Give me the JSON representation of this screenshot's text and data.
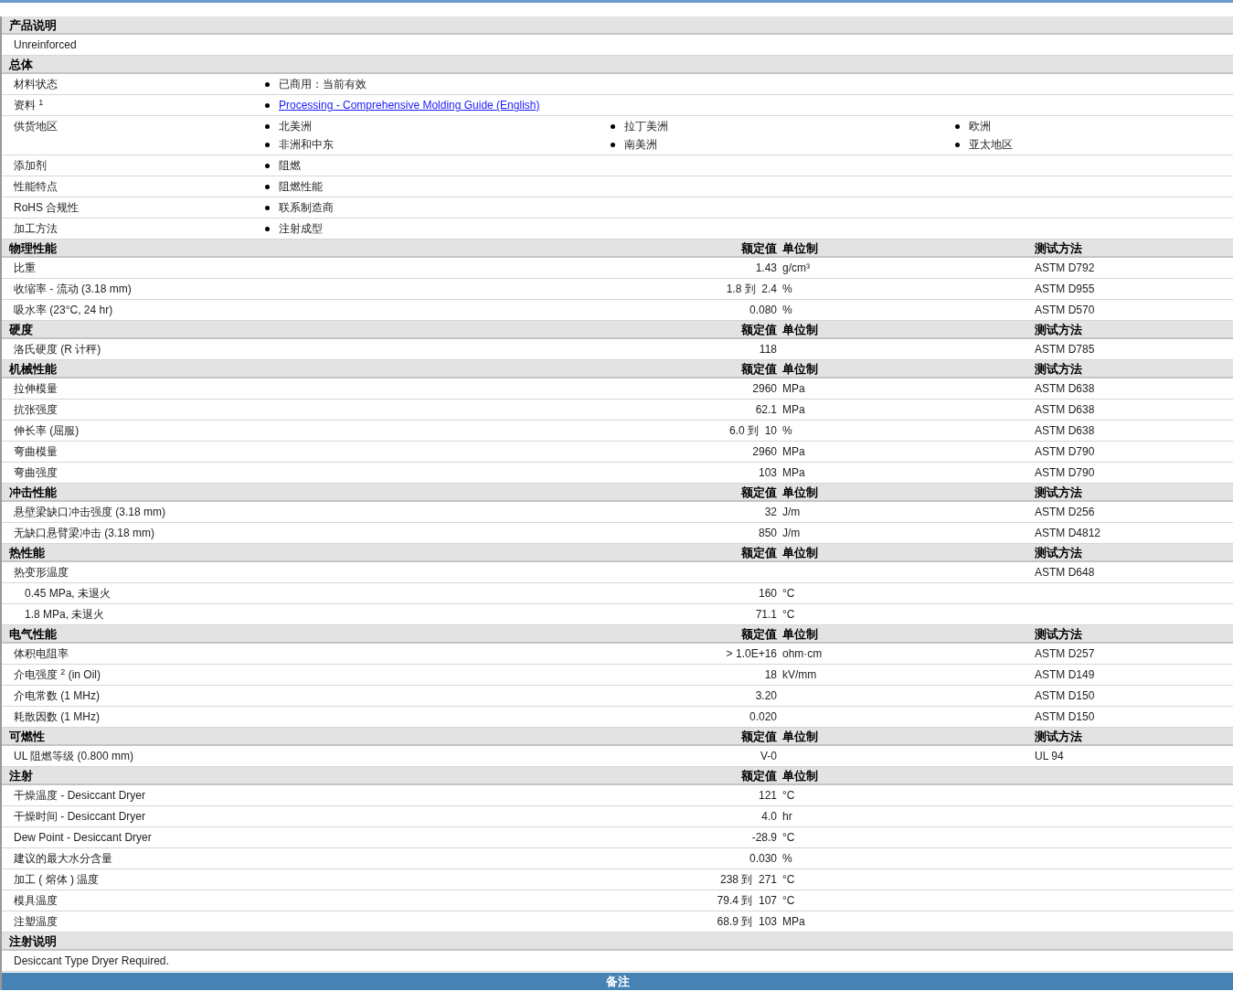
{
  "sections": [
    {
      "title": "产品说明",
      "kind": "text",
      "text": "Unreinforced"
    },
    {
      "title": "总体",
      "kind": "general",
      "rows": [
        {
          "label": "材料状态",
          "items": [
            {
              "kind": "text",
              "text": "已商用：当前有效"
            }
          ]
        },
        {
          "label": "资料 $^{1}$",
          "items": [
            {
              "kind": "link",
              "text": "Processing - Comprehensive Molding Guide (English)"
            }
          ]
        },
        {
          "label": "供货地区",
          "items": [
            {
              "kind": "text",
              "text": "北美洲"
            },
            {
              "kind": "text",
              "text": "拉丁美洲"
            },
            {
              "kind": "text",
              "text": "欧洲"
            },
            {
              "kind": "text",
              "text": "非洲和中东"
            },
            {
              "kind": "text",
              "text": "南美洲"
            },
            {
              "kind": "text",
              "text": "亚太地区"
            }
          ]
        },
        {
          "label": "添加剂",
          "items": [
            {
              "kind": "text",
              "text": "阻燃"
            }
          ]
        },
        {
          "label": "性能特点",
          "items": [
            {
              "kind": "text",
              "text": "阻燃性能"
            }
          ]
        },
        {
          "label": "RoHS 合规性",
          "items": [
            {
              "kind": "text",
              "text": "联系制造商"
            }
          ]
        },
        {
          "label": "加工方法",
          "items": [
            {
              "kind": "text",
              "text": "注射成型"
            }
          ]
        }
      ]
    },
    {
      "title": "物理性能",
      "kind": "properties",
      "header": {
        "value": "额定值",
        "unit": "单位制",
        "method": "测试方法"
      },
      "rows": [
        {
          "label": "比重",
          "value": "1.43",
          "unit": "g/cm³",
          "method": "ASTM D792"
        },
        {
          "label": "收缩率 - 流动 (3.18 mm)",
          "value": "1.8 到  2.4",
          "unit": "%",
          "method": "ASTM D955"
        },
        {
          "label": "吸水率 (23°C, 24 hr)",
          "value": "0.080",
          "unit": "%",
          "method": "ASTM D570"
        }
      ]
    },
    {
      "title": "硬度",
      "kind": "properties",
      "header": {
        "value": "额定值",
        "unit": "单位制",
        "method": "测试方法"
      },
      "rows": [
        {
          "label": "洛氏硬度 (R 计秤)",
          "value": "118",
          "method": "ASTM D785"
        }
      ]
    },
    {
      "title": "机械性能",
      "kind": "properties",
      "header": {
        "value": "额定值",
        "unit": "单位制",
        "method": "测试方法"
      },
      "rows": [
        {
          "label": "拉伸模量",
          "value": "2960",
          "unit": "MPa",
          "method": "ASTM D638"
        },
        {
          "label": "抗张强度",
          "value": "62.1",
          "unit": "MPa",
          "method": "ASTM D638"
        },
        {
          "label": "伸长率 (屈服)",
          "value": "6.0 到  10",
          "unit": "%",
          "method": "ASTM D638"
        },
        {
          "label": "弯曲模量",
          "value": "2960",
          "unit": "MPa",
          "method": "ASTM D790"
        },
        {
          "label": "弯曲强度",
          "value": "103",
          "unit": "MPa",
          "method": "ASTM D790"
        }
      ]
    },
    {
      "title": "冲击性能",
      "kind": "properties",
      "header": {
        "value": "额定值",
        "unit": "单位制",
        "method": "测试方法"
      },
      "rows": [
        {
          "label": "悬壁梁缺口冲击强度 (3.18 mm)",
          "value": "32",
          "unit": "J/m",
          "method": "ASTM D256"
        },
        {
          "label": "无缺口悬臂梁冲击 (3.18 mm)",
          "value": "850",
          "unit": "J/m",
          "method": "ASTM D4812"
        }
      ]
    },
    {
      "title": "热性能",
      "kind": "properties",
      "header": {
        "value": "额定值",
        "unit": "单位制",
        "method": "测试方法"
      },
      "rows": [
        {
          "label": "热变形温度",
          "method": "ASTM D648",
          "children": [
            {
              "label": "0.45 MPa, 未退火",
              "value": "160",
              "unit": "°C"
            },
            {
              "label": "1.8 MPa, 未退火",
              "value": "71.1",
              "unit": "°C"
            }
          ]
        }
      ]
    },
    {
      "title": "电气性能",
      "kind": "properties",
      "header": {
        "value": "额定值",
        "unit": "单位制",
        "method": "测试方法"
      },
      "rows": [
        {
          "label": "体积电阻率",
          "value": "> 1.0E+16",
          "unit": "ohm·cm",
          "method": "ASTM D257"
        },
        {
          "label": "介电强度 $^{2}$ (in Oil)",
          "value": "18",
          "unit": "kV/mm",
          "method": "ASTM D149"
        },
        {
          "label": "介电常数 (1 MHz)",
          "value": "3.20",
          "method": "ASTM D150"
        },
        {
          "label": "耗散因数 (1 MHz)",
          "value": "0.020",
          "method": "ASTM D150"
        }
      ]
    },
    {
      "title": "可燃性",
      "kind": "properties",
      "header": {
        "value": "额定值",
        "unit": "单位制",
        "method": "测试方法"
      },
      "rows": [
        {
          "label": "UL 阻燃等级 (0.800 mm)",
          "value": "V-0",
          "method": "UL 94"
        }
      ]
    },
    {
      "title": "注射",
      "kind": "properties",
      "header": {
        "value": "额定值",
        "unit": "单位制"
      },
      "rows": [
        {
          "label": "干燥温度 - Desiccant Dryer",
          "value": "121",
          "unit": "°C"
        },
        {
          "label": "干燥时间 - Desiccant Dryer",
          "value": "4.0",
          "unit": "hr"
        },
        {
          "label": "Dew Point - Desiccant Dryer",
          "value": "-28.9",
          "unit": "°C"
        },
        {
          "label": "建议的最大水分含量",
          "value": "0.030",
          "unit": "%"
        },
        {
          "label": "加工 ( 熔体 ) 温度",
          "value": "238 到  271",
          "unit": "°C"
        },
        {
          "label": "模具温度",
          "value": "79.4 到  107",
          "unit": "°C"
        },
        {
          "label": "注塑温度",
          "value": "68.9 到  103",
          "unit": "MPa"
        }
      ]
    },
    {
      "title": "注射说明",
      "kind": "text",
      "text": "Desiccant Type Dryer Required."
    }
  ],
  "notes_bar": {
    "title": "备注"
  }
}
